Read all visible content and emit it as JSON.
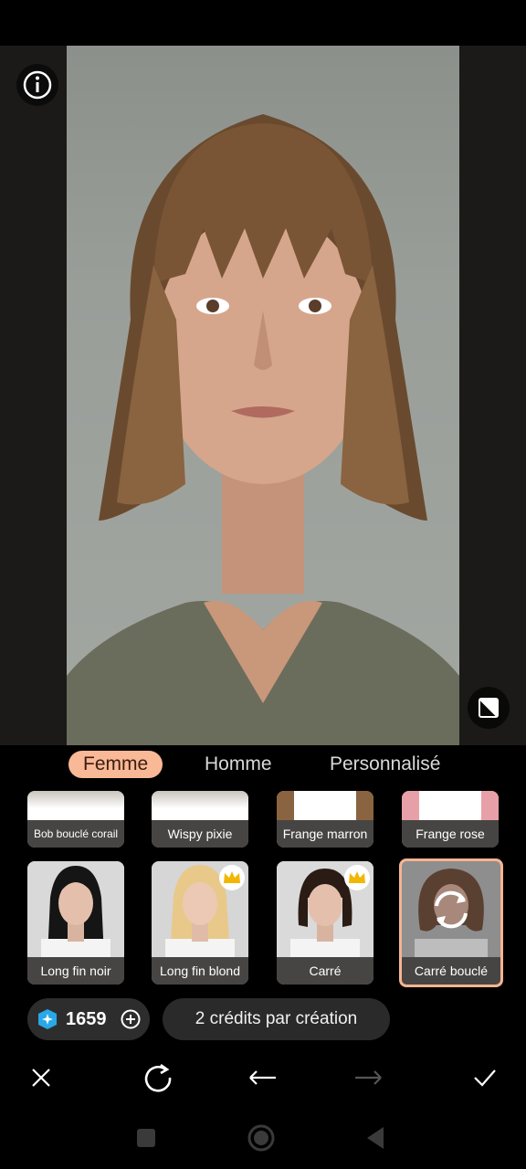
{
  "tabs": [
    {
      "label": "Femme"
    },
    {
      "label": "Homme"
    },
    {
      "label": "Personnalisé"
    }
  ],
  "styles_top": [
    {
      "label": "Bob bouclé corail"
    },
    {
      "label": "Wispy pixie"
    },
    {
      "label": "Frange marron"
    },
    {
      "label": "Frange rose"
    }
  ],
  "styles_main": [
    {
      "label": "Long fin noir",
      "premium": false
    },
    {
      "label": "Long fin blond",
      "premium": true
    },
    {
      "label": "Carré",
      "premium": true
    },
    {
      "label": "Carré bouclé",
      "premium": false,
      "selected": true
    }
  ],
  "credits": {
    "value": "1659",
    "tip": "2 crédits par création"
  },
  "colors": {
    "accent": "#f9b896",
    "background": "#000000"
  },
  "icons": [
    "info-icon",
    "compare-icon",
    "crown-icon",
    "refresh-icon",
    "gem-icon",
    "plus-icon",
    "close-icon",
    "redo-circle-icon",
    "undo-icon",
    "redo-icon",
    "check-icon"
  ]
}
